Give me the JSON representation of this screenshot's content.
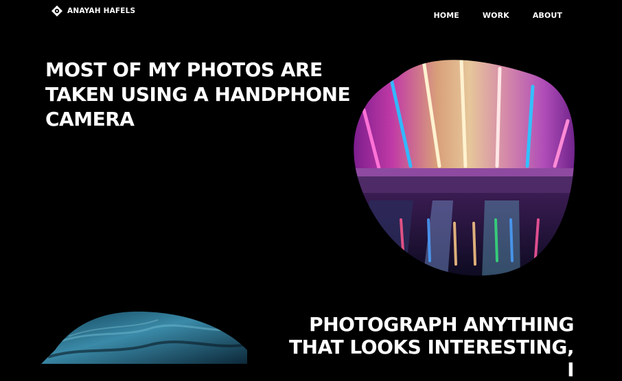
{
  "brand": {
    "name": "ANAYAH HAFELS",
    "logo_icon": "diamond-aperture-icon"
  },
  "nav": {
    "items": [
      {
        "label": "HOME"
      },
      {
        "label": "WORK"
      },
      {
        "label": "ABOUT"
      }
    ]
  },
  "sections": [
    {
      "title": "MOST OF MY PHOTOS ARE TAKEN USING A HANDPHONE CAMERA",
      "image": "neon-lights-photo"
    },
    {
      "title": "PHOTOGRAPH ANYTHING THAT LOOKS INTERESTING, I",
      "image": "blue-textured-photo"
    }
  ],
  "colors": {
    "background": "#000000",
    "text": "#ffffff"
  }
}
